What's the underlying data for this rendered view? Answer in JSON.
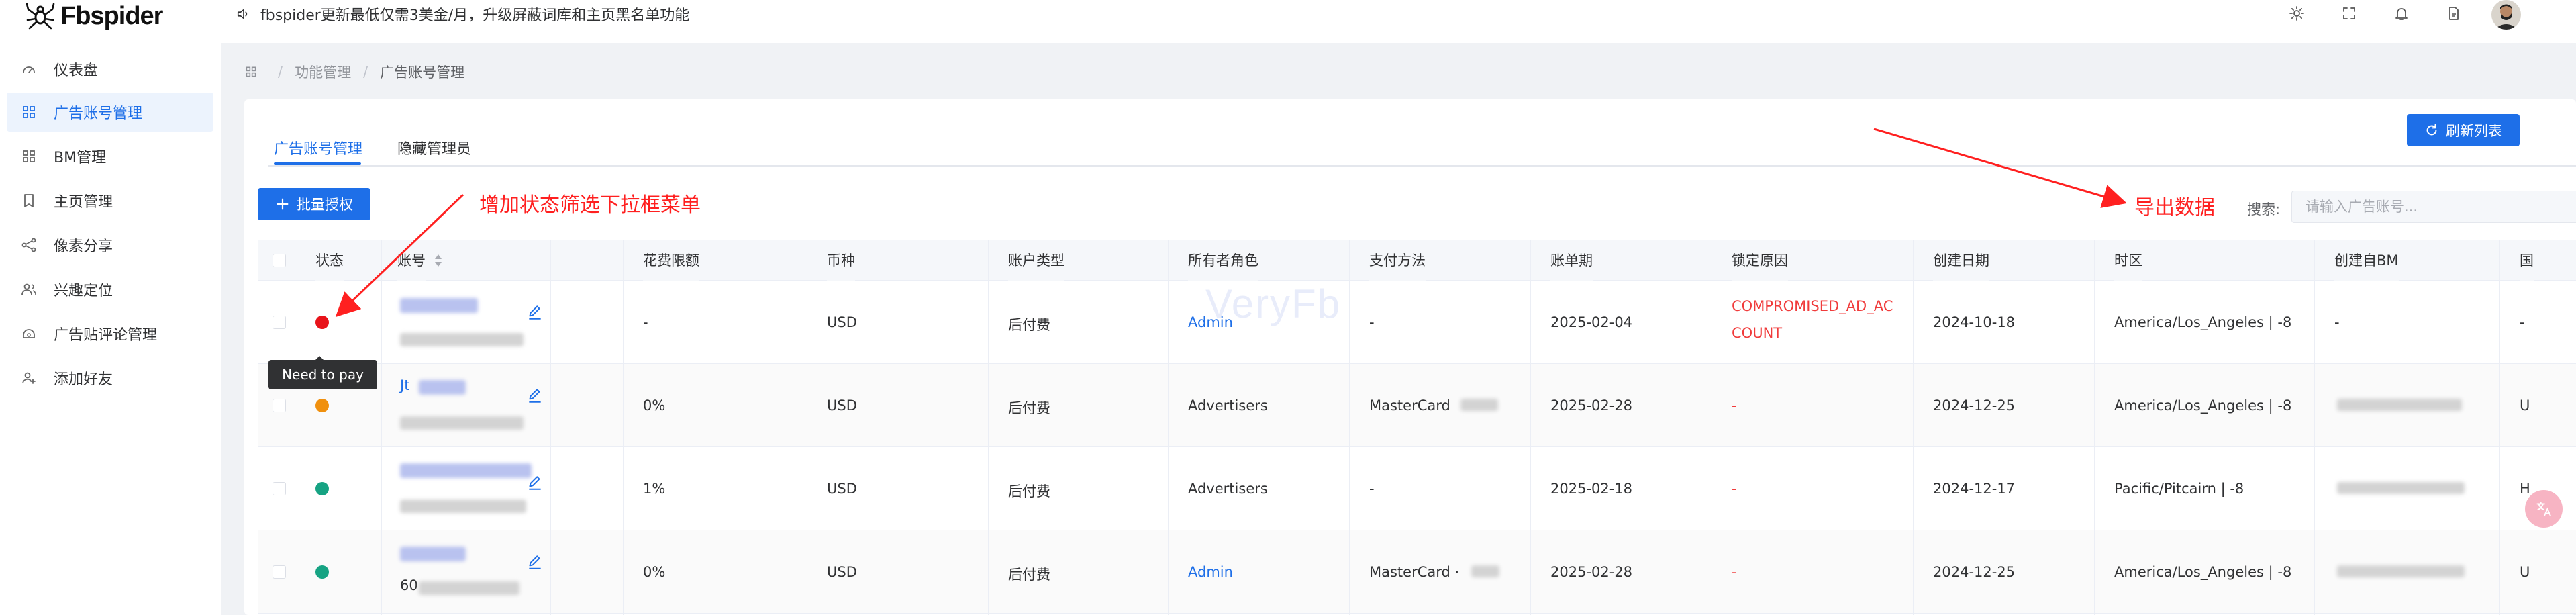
{
  "header": {
    "logo": "Fbspider",
    "notice": "fbspider更新最低仅需3美金/月，升级屏蔽词库和主页黑名单功能"
  },
  "sidebar": {
    "items": [
      {
        "label": "仪表盘",
        "icon": "dashboard-icon"
      },
      {
        "label": "广告账号管理",
        "icon": "grid-icon",
        "active": true
      },
      {
        "label": "BM管理",
        "icon": "grid-icon"
      },
      {
        "label": "主页管理",
        "icon": "bookmark-icon"
      },
      {
        "label": "像素分享",
        "icon": "share-icon"
      },
      {
        "label": "兴趣定位",
        "icon": "users-icon"
      },
      {
        "label": "广告贴评论管理",
        "icon": "comment-icon"
      },
      {
        "label": "添加好友",
        "icon": "add-user-icon"
      }
    ]
  },
  "breadcrumb": [
    "功能管理",
    "广告账号管理"
  ],
  "tabs": [
    "广告账号管理",
    "隐藏管理员"
  ],
  "buttons": {
    "refresh": "刷新列表",
    "batch_auth": "批量授权"
  },
  "search": {
    "label": "搜索:",
    "placeholder": "请输入广告账号..."
  },
  "table": {
    "columns": [
      "状态",
      "账号",
      "花费限额",
      "币种",
      "账户类型",
      "所有者角色",
      "支付方法",
      "账单期",
      "锁定原因",
      "创建日期",
      "时区",
      "创建自BM",
      "国"
    ],
    "rows": [
      {
        "status_color": "#e8131a",
        "spend_limit": "-",
        "currency": "USD",
        "account_type": "后付费",
        "owner_role": "Admin",
        "payment": "-",
        "billing": "2025-02-04",
        "lock_reason_1": "COMPROMISED_AD_AC",
        "lock_reason_2": "COUNT",
        "created": "2024-10-18",
        "timezone": "America/Los_Angeles | -8",
        "bm": "-",
        "country": "-"
      },
      {
        "status_color": "#f0900e",
        "account_prefix": "Jt",
        "spend_limit": "0%",
        "currency": "USD",
        "account_type": "后付费",
        "owner_role": "Advertisers",
        "payment": "MasterCard",
        "billing": "2025-02-28",
        "lock_reason": "-",
        "created": "2024-12-25",
        "timezone": "America/Los_Angeles | -8",
        "country": "U"
      },
      {
        "status_color": "#16a383",
        "spend_limit": "1%",
        "currency": "USD",
        "account_type": "后付费",
        "owner_role": "Advertisers",
        "payment": "-",
        "billing": "2025-02-18",
        "lock_reason": "-",
        "created": "2024-12-17",
        "timezone": "Pacific/Pitcairn | -8",
        "country": "H"
      },
      {
        "status_color": "#16a383",
        "account_prefix": "60",
        "spend_limit": "0%",
        "currency": "USD",
        "account_type": "后付费",
        "owner_role": "Admin",
        "payment": "MasterCard ·",
        "billing": "2025-02-28",
        "lock_reason": "-",
        "created": "2024-12-25",
        "timezone": "America/Los_Angeles | -8",
        "country": "U"
      }
    ]
  },
  "tooltip": "Need to pay",
  "annotations": {
    "filter": "增加状态筛选下拉框菜单",
    "export": "导出数据"
  },
  "watermark": "VeryFb",
  "colors": {
    "primary": "#1e6fe8",
    "danger": "#f03b3b",
    "annotation": "#ff2020"
  }
}
